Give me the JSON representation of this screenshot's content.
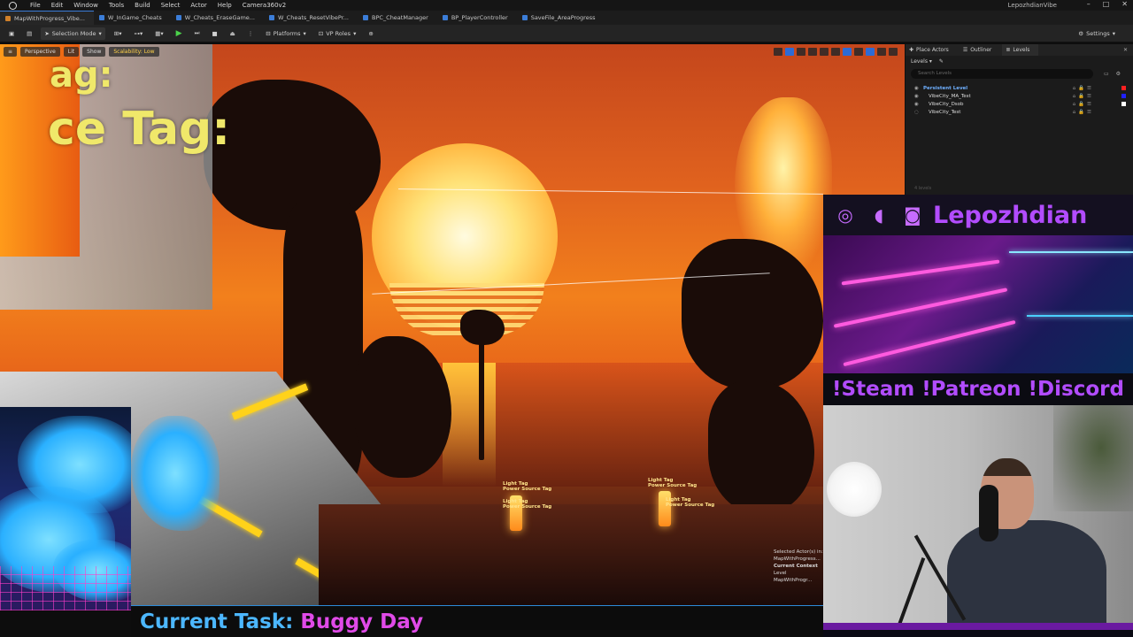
{
  "menu": {
    "items": [
      "File",
      "Edit",
      "Window",
      "Tools",
      "Build",
      "Select",
      "Actor",
      "Help",
      "Camera360v2"
    ],
    "user": "LepozhdianVibe"
  },
  "tabs": [
    "MapWithProgress_Vibe...",
    "W_InGame_Cheats",
    "W_Cheats_EraseGame...",
    "W_Cheats_ResetVibePr...",
    "BPC_CheatManager",
    "BP_PlayerController",
    "SaveFile_AreaProgress"
  ],
  "toolbar": {
    "selection_mode": "Selection Mode",
    "platforms": "Platforms",
    "vp_roles": "VP Roles",
    "settings": "Settings"
  },
  "viewport": {
    "hud": {
      "perspective": "Perspective",
      "lit": "Lit",
      "show": "Show",
      "scalability": "Scalability: Low"
    },
    "text_line1": "ag:",
    "text_line2": "ce Tag:",
    "tag_labels": [
      {
        "light": "Light Tag",
        "power": "Power Source Tag"
      },
      {
        "light": "Light Tag",
        "power": "Power Source Tag"
      },
      {
        "light": "Light Tag",
        "power": "Power Source Tag"
      },
      {
        "light": "Light Tag",
        "power": "Power Source Tag"
      }
    ],
    "selected_info": {
      "line1": "Selected Actor(s) in:",
      "line2": "MapWithProgress...",
      "line3": "Current Context",
      "line4": "Level",
      "line5": "MapWithProgr..."
    }
  },
  "outliner": {
    "tabs": [
      "Place Actors",
      "Outliner",
      "Levels"
    ],
    "levels_label": "Levels",
    "search_placeholder": "Search Levels",
    "rows": [
      {
        "name": "Persistent Level",
        "color": "#ff2020"
      },
      {
        "name": "VibeCity_MA_Test",
        "color": "#2020ff"
      },
      {
        "name": "VibeCity_Dsob",
        "color": "#ffffff"
      },
      {
        "name": "VibeCity_Test",
        "color": ""
      }
    ],
    "count": "4 levels"
  },
  "overlay": {
    "streamer_name": "Lepozhdian",
    "links": "!Steam !Patreon !Discord",
    "task_label": "Current Task:",
    "task_value": "Buggy Day"
  }
}
